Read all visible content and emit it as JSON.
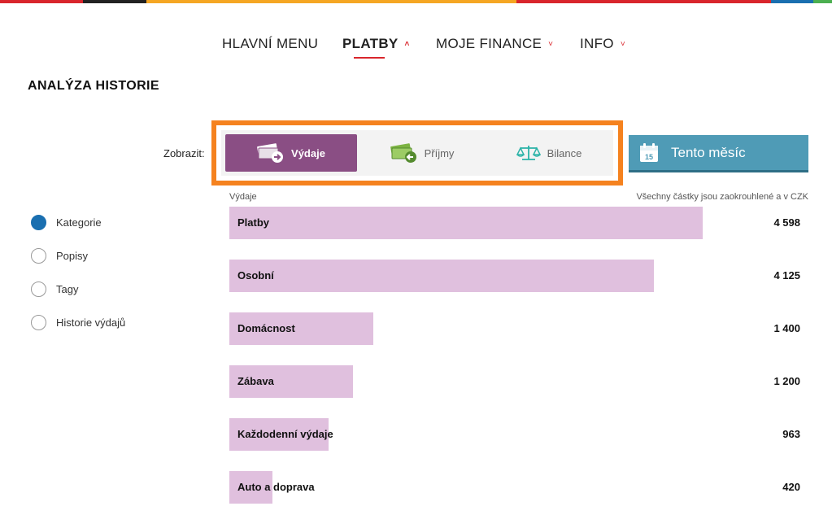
{
  "stripe_colors": [
    "#d9262c",
    "#222222",
    "#f5a623",
    "#d9262c",
    "#1a6fb0",
    "#4caf50"
  ],
  "nav": {
    "items": [
      {
        "label": "HLAVNÍ MENU",
        "chevron": ""
      },
      {
        "label": "PLATBY",
        "chevron": "˄"
      },
      {
        "label": "MOJE FINANCE",
        "chevron": "˅"
      },
      {
        "label": "INFO",
        "chevron": "˅"
      }
    ]
  },
  "page": {
    "title": "ANALÝZA HISTORIE"
  },
  "filter": {
    "label": "Zobrazit:",
    "options": [
      {
        "label": "Výdaje",
        "icon": "money-out-icon"
      },
      {
        "label": "Příjmy",
        "icon": "money-in-icon"
      },
      {
        "label": "Bilance",
        "icon": "scales-icon"
      }
    ],
    "selected": "Výdaje"
  },
  "period_button": {
    "label": "Tento měsíc",
    "icon": "calendar-icon",
    "calendar_day": "15"
  },
  "list": {
    "header_left": "Výdaje",
    "header_right": "Všechny částky jsou zaokrouhlené a v CZK"
  },
  "views": [
    {
      "label": "Kategorie",
      "checked": true
    },
    {
      "label": "Popisy",
      "checked": false
    },
    {
      "label": "Tagy",
      "checked": false
    },
    {
      "label": "Historie výdajů",
      "checked": false
    }
  ],
  "chart_data": {
    "type": "bar",
    "categories": [
      "Platby",
      "Osobní",
      "Domácnost",
      "Zábava",
      "Každodenní výdaje",
      "Auto a doprava"
    ],
    "values": [
      4598,
      4125,
      1400,
      1200,
      963,
      420
    ],
    "value_labels": [
      "4 598",
      "4 125",
      "1 400",
      "1 200",
      "963",
      "420"
    ],
    "color": "#e0c0de"
  }
}
